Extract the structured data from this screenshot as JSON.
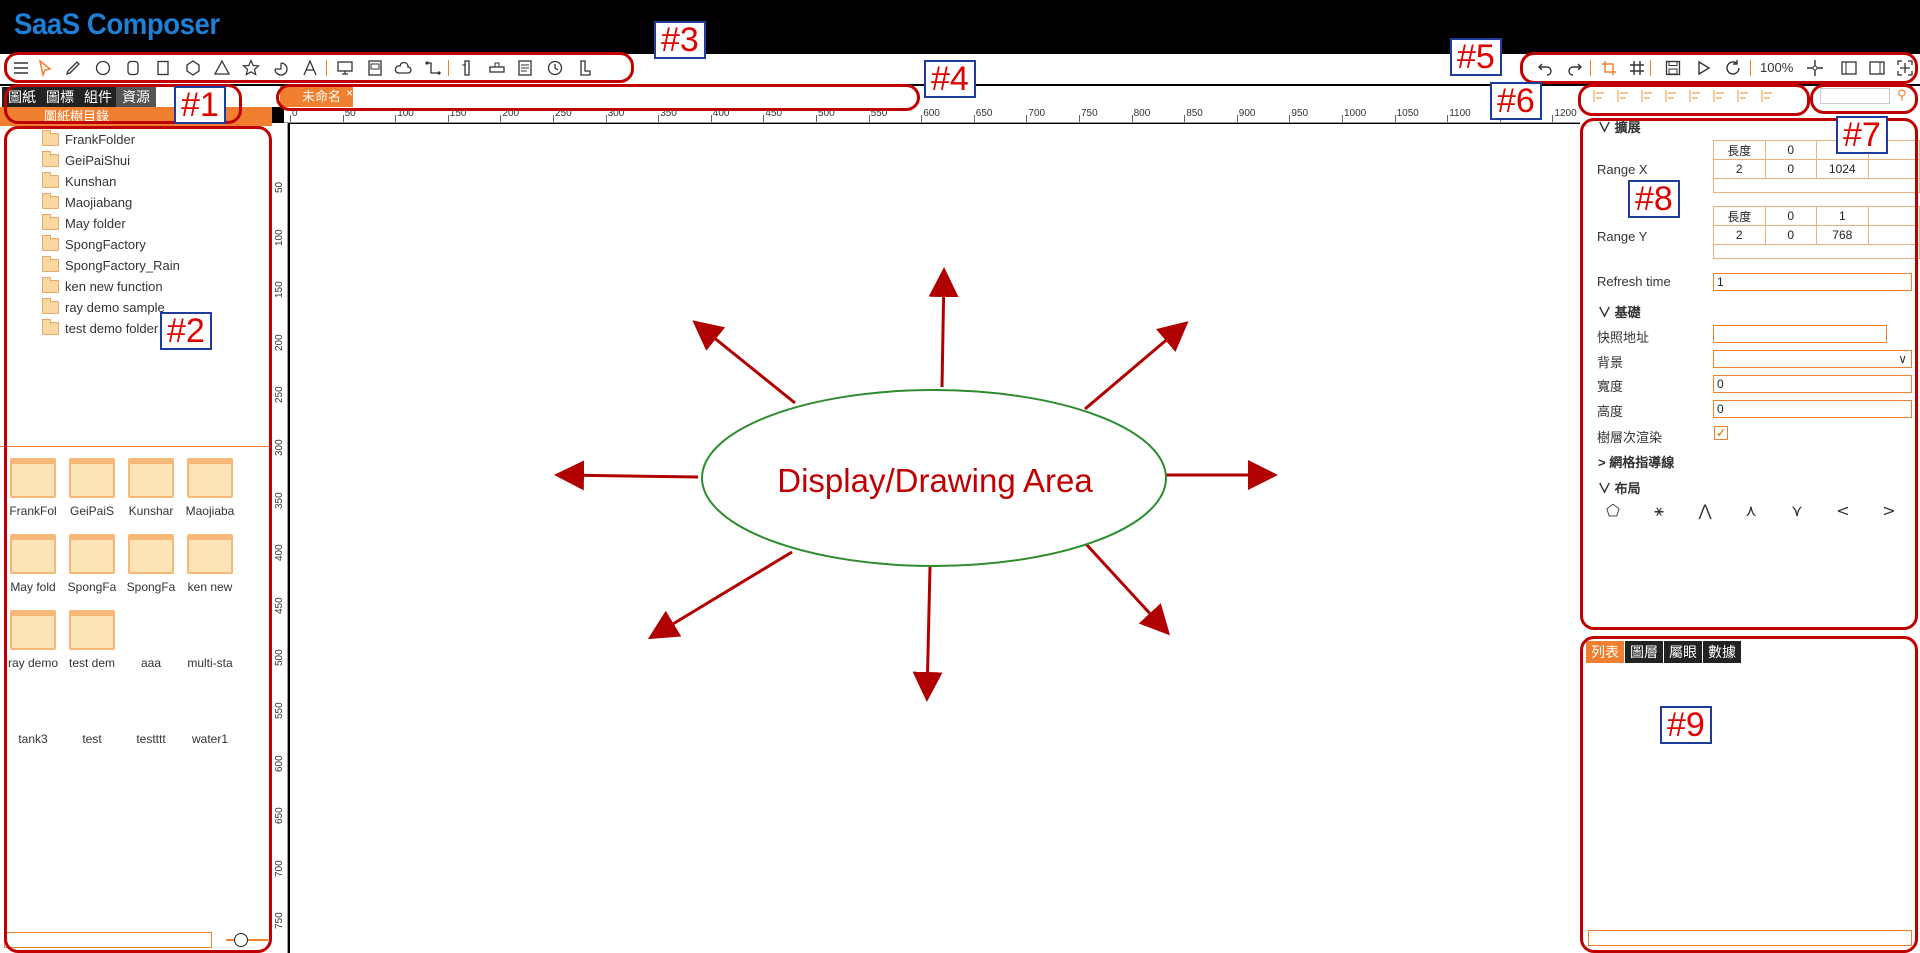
{
  "app": {
    "title": "SaaS Composer"
  },
  "toolbar": {
    "zoom": "100%"
  },
  "left": {
    "tabs": [
      "圖紙",
      "圖標",
      "組件",
      "資源"
    ],
    "header": "圖紙樹目錄",
    "tree": [
      "FrankFolder",
      "GeiPaiShui",
      "Kunshan",
      "Maojiabang",
      "May folder",
      "SpongFactory",
      "SpongFactory_Rain",
      "ken new function",
      "ray demo sample",
      "test demo folder"
    ],
    "grid": [
      "FrankFol",
      "GeiPaiS",
      "Kunshar",
      "Maojiaba",
      "May fold",
      "SpongFa",
      "SpongFa",
      "ken new",
      "ray demo",
      "test dem",
      "aaa",
      "multi-sta",
      "tank3",
      "test",
      "testttt",
      "water1"
    ]
  },
  "doc_tab": {
    "label": "未命名",
    "close": "×"
  },
  "ruler_h": [
    "0",
    "50",
    "100",
    "150",
    "200",
    "250",
    "300",
    "350",
    "400",
    "450",
    "500",
    "550",
    "600",
    "650",
    "700",
    "750",
    "800",
    "850",
    "900",
    "950",
    "1000",
    "1050",
    "1100",
    "1150",
    "1200"
  ],
  "ruler_v": [
    "50",
    "100",
    "150",
    "200",
    "250",
    "300",
    "350",
    "400",
    "450",
    "500",
    "550",
    "600",
    "650",
    "700",
    "750"
  ],
  "canvas": {
    "center_label": "Display/Drawing Area"
  },
  "props": {
    "section_extend": "擴展",
    "range_x_label": "Range X",
    "range_x": [
      [
        "長度",
        "0",
        ""
      ],
      [
        "2",
        "0",
        "1024"
      ]
    ],
    "range_y_label": "Range Y",
    "range_y": [
      [
        "長度",
        "0",
        "1"
      ],
      [
        "2",
        "0",
        "768"
      ]
    ],
    "refresh_label": "Refresh time",
    "refresh_value": "1",
    "section_basic": "基礎",
    "snapshot_label": "快照地址",
    "background_label": "背景",
    "width_label": "寬度",
    "width_value": "0",
    "height_label": "高度",
    "height_value": "0",
    "layer_render_label": "樹層次渲染",
    "grid_guide_label": "網格指導線",
    "section_layout": "布局"
  },
  "right_tabs": [
    "列表",
    "圖層",
    "屬眼",
    "數據"
  ],
  "annotations": [
    "#1",
    "#2",
    "#3",
    "#4",
    "#5",
    "#6",
    "#7",
    "#8",
    "#9"
  ],
  "colors": {
    "accent": "#f08030",
    "title": "#1e7fd6",
    "annot": "#c00000",
    "ellipse": "#2e8b2e",
    "arrow": "#b00000"
  }
}
